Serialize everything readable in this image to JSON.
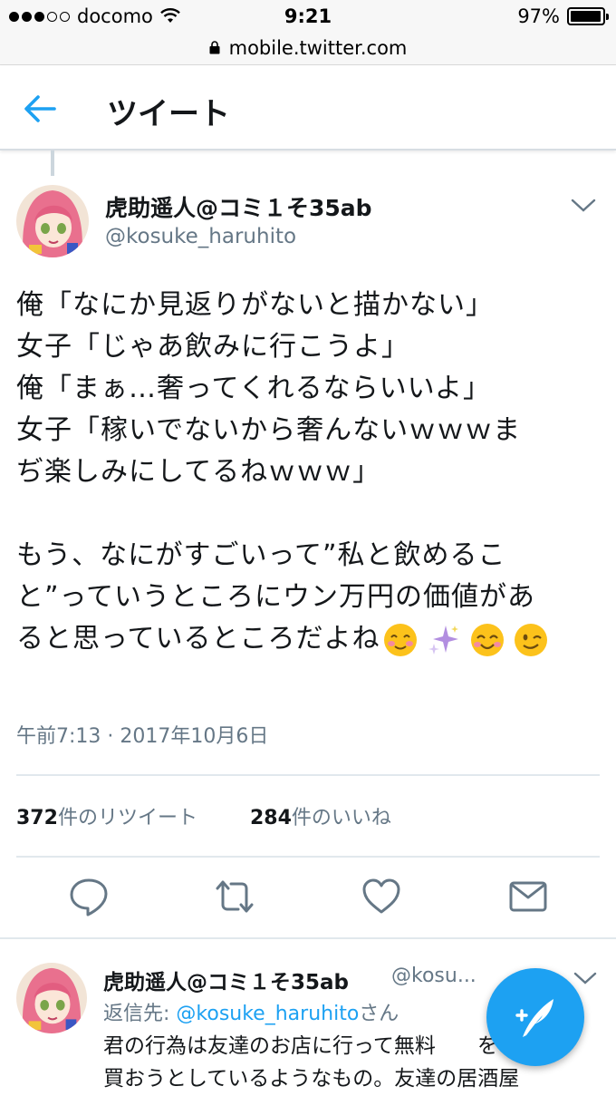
{
  "status_bar": {
    "carrier": "docomo",
    "time": "9:21",
    "battery": "97%"
  },
  "url_bar": {
    "url": "mobile.twitter.com"
  },
  "header": {
    "title": "ツイート"
  },
  "tweet": {
    "author_name": "虎助遥人@コミ１そ35ab",
    "author_handle": "@kosuke_haruhito",
    "text": "俺「なにか見返りがないと描かない」\n女子「じゃあ飲みに行こうよ」\n俺「まぁ…奢ってくれるならいいよ」\n女子「稼いでないから奢んないｗｗｗま\nぢ楽しみにしてるねｗｗｗ」\n\nもう、なにがすごいって”私と飲めるこ\nと”っていうところにウン万円の価値があ\nると思っているところだよね",
    "emojis": [
      "smiling-blush-emoji",
      "sparkles-emoji",
      "smiling-eyes-emoji",
      "winking-emoji"
    ],
    "timestamp": "午前7:13 · 2017年10月6日",
    "retweets_count": "372",
    "retweets_label": "件のリツイート",
    "likes_count": "284",
    "likes_label": "件のいいね"
  },
  "actions": [
    "reply-icon",
    "retweet-icon",
    "like-icon",
    "message-icon"
  ],
  "reply": {
    "author_name": "虎助遥人@コミ１そ35ab",
    "author_handle": "@kosu...",
    "reply_to_label": "返信先: ",
    "reply_to_handle": "@kosuke_haruhito",
    "reply_to_suffix": "さん",
    "text": "君の行為は友達のお店に行って無料　　を\n買おうとしているようなもの。友達の居酒屋"
  },
  "colors": {
    "accent": "#1da1f2",
    "secondary_text": "#657786",
    "divider": "#e1e8ed"
  },
  "battery_level": 0.97
}
